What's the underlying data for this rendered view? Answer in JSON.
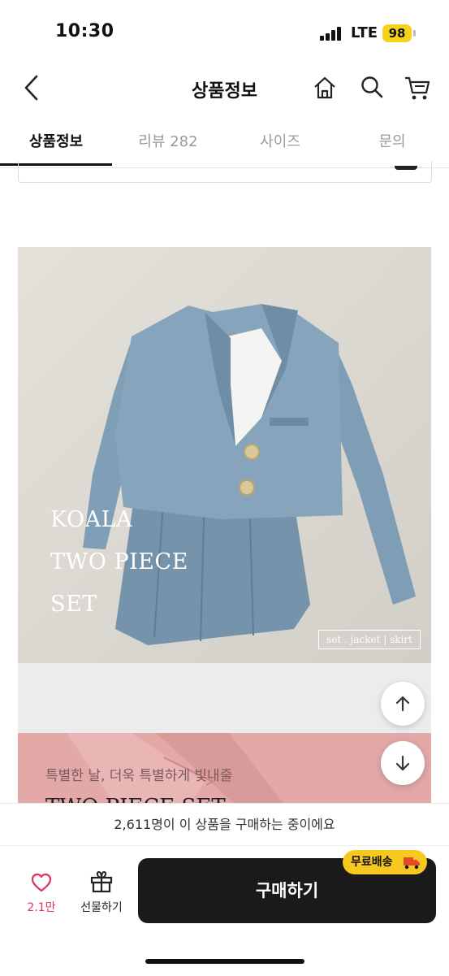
{
  "status_bar": {
    "time": "10:30",
    "network": "LTE",
    "battery": "98"
  },
  "header": {
    "title": "상품정보",
    "icons": [
      "back-icon",
      "home-icon",
      "search-icon",
      "cart-icon"
    ]
  },
  "tabs": [
    {
      "label": "상품정보",
      "active": true
    },
    {
      "label": "리뷰 282",
      "active": false
    },
    {
      "label": "사이즈",
      "active": false
    },
    {
      "label": "문의",
      "active": false
    }
  ],
  "product_image": {
    "overlay_lines": [
      "KOALA",
      "TWO PIECE",
      "SET"
    ],
    "tag": "set . jacket | skirt"
  },
  "second_image": {
    "caption": "특별한 날, 더욱 특별하게 빛내줄",
    "title": "TWO PIECE SET"
  },
  "notice": "2,611명이 이 상품을 구매하는 중이에요",
  "bottom_bar": {
    "like_count": "2.1만",
    "gift_label": "선물하기",
    "buy_label": "구매하기",
    "free_shipping_badge": "무료배송"
  },
  "colors": {
    "accent_yellow": "#f7c81e",
    "like_red": "#e0325a",
    "buy_button": "#1a1a1a",
    "jacket_blue": "#7f9db4",
    "pink_fabric": "#e3a8a8"
  }
}
